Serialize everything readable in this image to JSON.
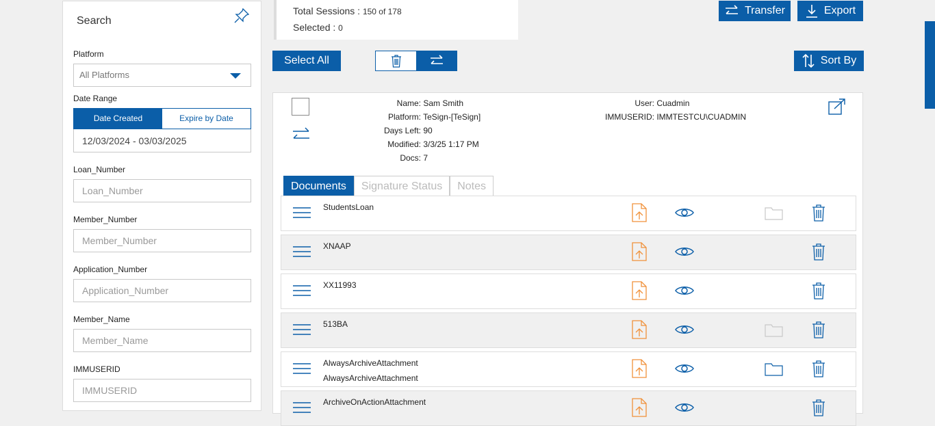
{
  "sidebar": {
    "title": "Search",
    "platform_label": "Platform",
    "platform_value": "All Platforms",
    "date_range_label": "Date Range",
    "date_created_label": "Date Created",
    "expire_by_date_label": "Expire by Date",
    "date_range_value": "12/03/2024 - 03/03/2025",
    "fields": [
      {
        "label": "Loan_Number",
        "placeholder": "Loan_Number"
      },
      {
        "label": "Member_Number",
        "placeholder": "Member_Number"
      },
      {
        "label": "Application_Number",
        "placeholder": "Application_Number"
      },
      {
        "label": "Member_Name",
        "placeholder": "Member_Name"
      },
      {
        "label": "IMMUSERID",
        "placeholder": "IMMUSERID"
      }
    ]
  },
  "counts": {
    "total_label": "Total Sessions : ",
    "total_value": "150 of 178",
    "selected_label": "Selected : ",
    "selected_value": "0"
  },
  "toolbar": {
    "transfer_label": "Transfer",
    "export_label": "Export",
    "select_all_label": "Select All",
    "sort_by_label": "Sort By"
  },
  "session": {
    "name_label": "Name:",
    "name": "Sam Smith",
    "platform_label": "Platform:",
    "platform": "TeSign-[TeSign]",
    "days_left_label": "Days Left:",
    "days_left": "90",
    "modified_label": "Modified:",
    "modified": "3/3/25 1:17 PM",
    "docs_label": "Docs:",
    "docs": "7",
    "user_label": "User:",
    "user": "Cuadmin",
    "immuserid_label": "IMMUSERID:",
    "immuserid": "IMMTESTCU\\CUADMIN"
  },
  "tabs": [
    "Documents",
    "Signature Status",
    "Notes"
  ],
  "documents": [
    {
      "name": "StudentsLoan",
      "name2": "",
      "folder": "faded"
    },
    {
      "name": "XNAAP",
      "name2": "",
      "folder": "none"
    },
    {
      "name": "XX11993",
      "name2": "",
      "folder": "none"
    },
    {
      "name": "513BA",
      "name2": "",
      "folder": "faded"
    },
    {
      "name": "AlwaysArchiveAttachment",
      "name2": "AlwaysArchiveAttachment",
      "folder": "active"
    },
    {
      "name": "ArchiveOnActionAttachment",
      "name2": "",
      "folder": "none"
    }
  ],
  "colors": {
    "primary": "#0b5ea8",
    "upload": "#f0913a",
    "faded": "#c8c8c8"
  }
}
